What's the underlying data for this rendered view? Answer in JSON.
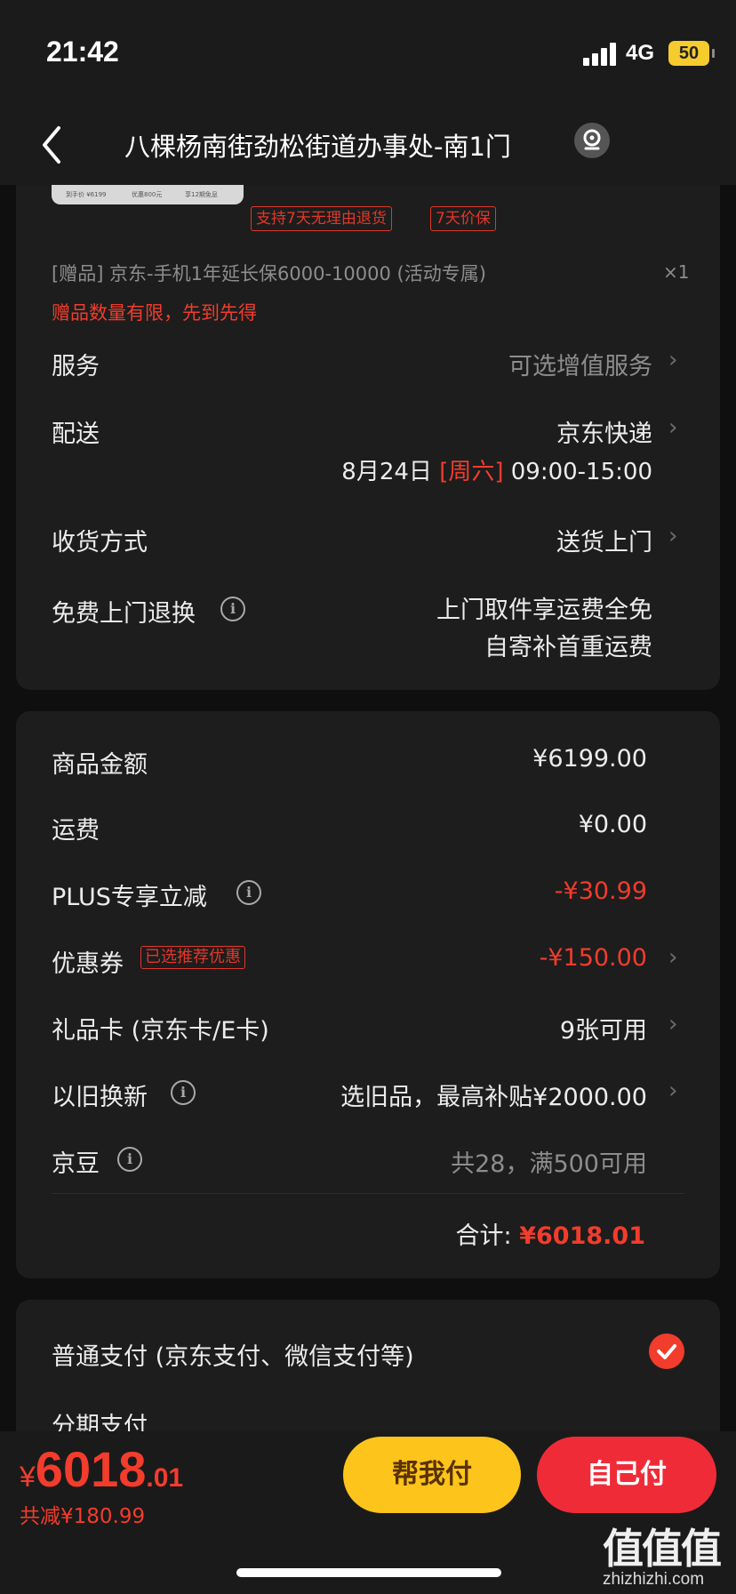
{
  "status_bar": {
    "time": "21:42",
    "network": "4G",
    "battery": "50"
  },
  "nav": {
    "title": "八棵杨南街劲松街道办事处-南1门",
    "back_icon": "chevron-left-icon",
    "location_icon": "location-pin-icon"
  },
  "product": {
    "thumb_texts": [
      "到手价 ¥6199",
      "优惠800元",
      "享12期免息"
    ],
    "tags": [
      "支持7天无理由退货",
      "7天价保"
    ],
    "gift_line": "[赠品] 京东-手机1年延长保6000-10000 (活动专属)",
    "gift_qty": "×1",
    "gift_note": "赠品数量有限，先到先得"
  },
  "services": {
    "service_label": "服务",
    "service_value": "可选增值服务",
    "delivery_label": "配送",
    "delivery_value": "京东快递",
    "delivery_date": "8月24日",
    "delivery_weekday": "[周六]",
    "delivery_time": "09:00-15:00",
    "receive_label": "收货方式",
    "receive_value": "送货上门",
    "return_label": "免费上门退换",
    "return_line1": "上门取件享运费全免",
    "return_line2": "自寄补首重运费"
  },
  "costs": {
    "goods_label": "商品金额",
    "goods_value": "¥6199.00",
    "shipping_label": "运费",
    "shipping_value": "¥0.00",
    "plus_label": "PLUS专享立减",
    "plus_value": "-¥30.99",
    "coupon_label": "优惠券",
    "coupon_tag": "已选推荐优惠",
    "coupon_value": "-¥150.00",
    "giftcard_label": "礼品卡 (京东卡/E卡)",
    "giftcard_value": "9张可用",
    "tradein_label": "以旧换新",
    "tradein_value": "选旧品，最高补贴¥2000.00",
    "jingdou_label": "京豆",
    "jingdou_value": "共28，满500可用",
    "total_label": "合计:",
    "total_value": "¥6018.01"
  },
  "payment": {
    "normal_label": "普通支付 (京东支付、微信支付等)",
    "installment_label": "分期支付"
  },
  "bottom": {
    "currency": "¥",
    "price_int": "6018",
    "price_dec": ".01",
    "saved": "共减¥180.99",
    "help_pay": "帮我付",
    "self_pay": "自己付"
  },
  "watermark": {
    "text": "值值值",
    "sub": "zhizhizhi.com"
  },
  "colors": {
    "accent_red": "#f23c2c",
    "help_yellow": "#fdc41b",
    "pay_red": "#f02b38",
    "card_bg": "#1d1d1d"
  }
}
